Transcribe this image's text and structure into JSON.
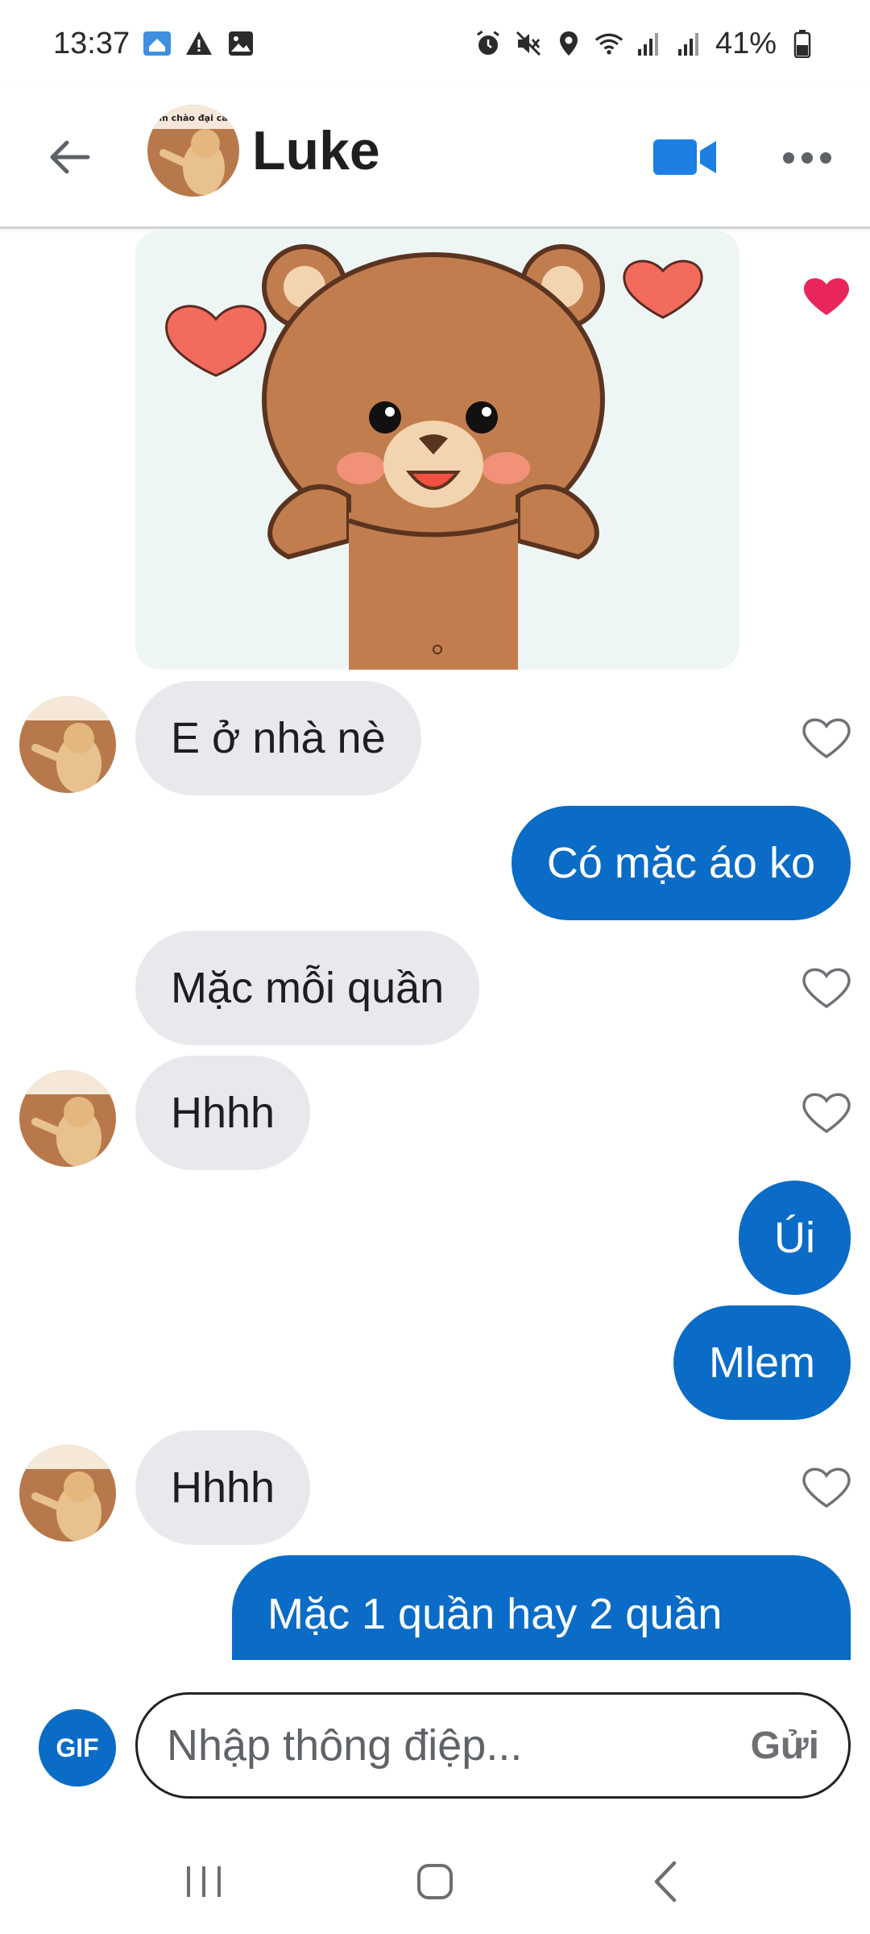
{
  "status_bar": {
    "time": "13:37",
    "battery": "41%",
    "left_icons": [
      "home-notification-icon",
      "warning-icon",
      "image-icon"
    ],
    "right_icons": [
      "alarm-icon",
      "mute-icon",
      "location-icon",
      "wifi-icon",
      "signal-icon",
      "signal-icon",
      "battery-icon"
    ]
  },
  "header": {
    "contact_name": "Luke",
    "avatar_caption": "m chào đại ca",
    "back_icon": "arrow-left-icon",
    "video_icon": "video-camera-icon",
    "more_icon": "more-horizontal-icon"
  },
  "messages": [
    {
      "type": "sticker",
      "sender": "contact",
      "content": "bear-hearts-sticker",
      "liked": true
    },
    {
      "type": "text",
      "sender": "contact",
      "text": "E ở nhà nè",
      "show_avatar": true,
      "liked": false
    },
    {
      "type": "text",
      "sender": "me",
      "text": "Có mặc áo ko"
    },
    {
      "type": "text",
      "sender": "contact",
      "text": "Mặc mỗi quần",
      "show_avatar": false,
      "liked": false
    },
    {
      "type": "text",
      "sender": "contact",
      "text": "Hhhh",
      "show_avatar": true,
      "liked": false
    },
    {
      "type": "text",
      "sender": "me",
      "text": "Úi"
    },
    {
      "type": "text",
      "sender": "me",
      "text": "Mlem"
    },
    {
      "type": "text",
      "sender": "contact",
      "text": "Hhhh",
      "show_avatar": true,
      "liked": false
    },
    {
      "type": "text",
      "sender": "me",
      "text": "Mặc 1 quần hay 2 quần"
    }
  ],
  "composer": {
    "gif_label": "GIF",
    "placeholder": "Nhập thông điệp...",
    "send_label": "Gửi"
  },
  "nav": {
    "recents_icon": "recents-icon",
    "home_icon": "home-icon",
    "back_icon": "back-icon"
  },
  "colors": {
    "accent": "#0a6cc6",
    "incoming_bubble": "#e9e9ed",
    "liked_heart": "#e8265a"
  }
}
